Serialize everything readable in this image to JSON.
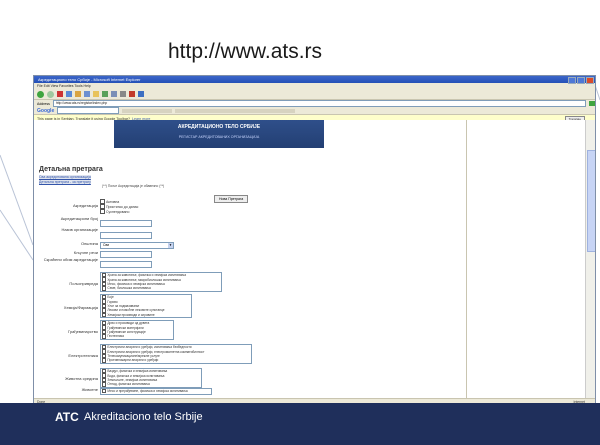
{
  "slide": {
    "url_title": "http://www.ats.rs",
    "footer_mark": "ATC",
    "footer_text": "Akreditaciono telo Srbije"
  },
  "browser": {
    "title": "Акредитационо тело Србије - Microsoft Internet Explorer",
    "menu": "File  Edit  View  Favorites  Tools  Help",
    "address": "http://www.ats.rs/registar/index.php",
    "google_label": "Google",
    "translate_text": "This page is in Serbian.  Translate it using Google Toolbar?",
    "translate_link": "Learn more",
    "translate_button": "Translate",
    "status_left": "Done",
    "status_right": "Internet"
  },
  "page": {
    "banner_title": "АКРЕДИТАЦИОНО ТЕЛО СРБИЈЕ",
    "banner_subtitle": "РЕГИСТАР АКРЕДИТОВАНИХ ОРГАНИЗАЦИЈА",
    "heading": "Детаљна претрага",
    "link1": "Сва акредитована организација",
    "link2": "Детаљна претрага - за претрагу",
    "hint": "(**) Поље Акредитација је обавезно (**)",
    "search_button": "Нова Претрага",
    "labels": {
      "accreditation": "Акредитација",
      "acc_number": "Акредитациони број",
      "org_name": "Назив организације",
      "municipality": "Општина",
      "keyword": "Кључне речи",
      "scope": "Скраћени обим акредитације",
      "agriculture": "Пољопривреда",
      "chemistry": "Хемија/Фармација",
      "construction": "Грађевинарство",
      "electrical": "Електротехника",
      "environment": "Животна средина",
      "food": "Животне"
    },
    "checkboxes": [
      "Активна",
      "Пристигао до данас",
      "Суспендовано"
    ],
    "municipality_value": "Сви",
    "agri_options": [
      "Храна за животиње, физичка и хемијска испитивања",
      "Храна за животиње, микробиолошка испитивања",
      "Месо, физичка и хемијска испитивања",
      "Семе, биолошка испитивања"
    ],
    "chem_options": [
      "Боје",
      "Гориво",
      "Уље за подмазивање",
      "Лекови и помоћне лековите супстанце",
      "Хемијски производи и сировине"
    ],
    "constr_options": [
      "Дрво и производи од дрвета",
      "Грађевински материјали",
      "Грађевинске конструкције",
      "Геотехника"
    ],
    "elec_options": [
      "Електрични апарати и уређаји, испитивања безбедности",
      "Електрични апарати и уређаји, електромагнетна компатибилност",
      "Телекомуникационе/мрежне услуге",
      "Противпожарни апарати и уређаји"
    ],
    "env_options": [
      "Ваздух, физичка и хемијска испитивања",
      "Вода, физичка и хемијска испитивања",
      "Земљиште, хемијска испитивања",
      "Отпад, физичка испитивања"
    ],
    "food_options": [
      "Месо и прерађевине, физичка и хемијска испитивања"
    ]
  },
  "colors": {
    "footer_bg": "#1f2f5b",
    "banner_bg": "#2f4f8a",
    "titlebar": "#2450b7"
  }
}
